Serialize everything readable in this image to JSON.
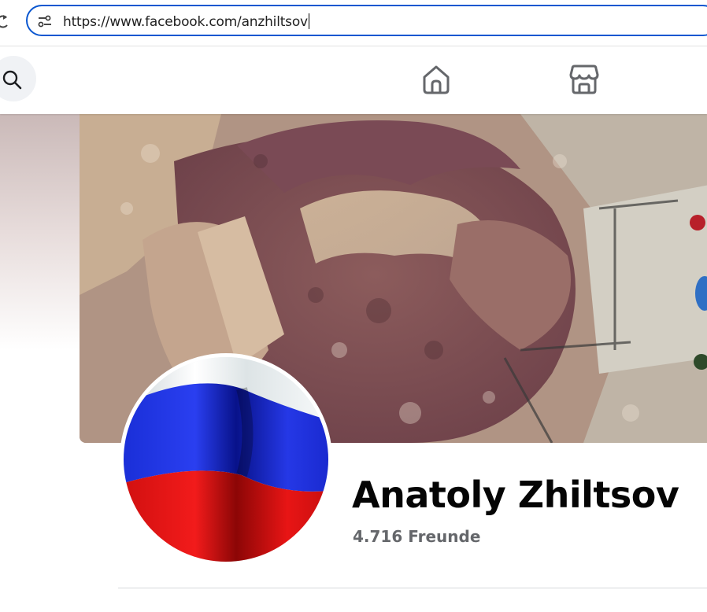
{
  "browser": {
    "url": "https://www.facebook.com/anzhiltsov",
    "icons": {
      "reload": "reload-icon",
      "site_info": "site-info-icon"
    },
    "accent_color": "#0b57d0"
  },
  "fb_nav": {
    "icons": [
      "search-icon",
      "home-icon",
      "marketplace-icon"
    ]
  },
  "profile": {
    "name": "Anatoly Zhiltsov",
    "friends": "4.716 Freunde",
    "avatar": "russian-flag",
    "name_color": "#050505",
    "friends_color": "#65676b"
  }
}
